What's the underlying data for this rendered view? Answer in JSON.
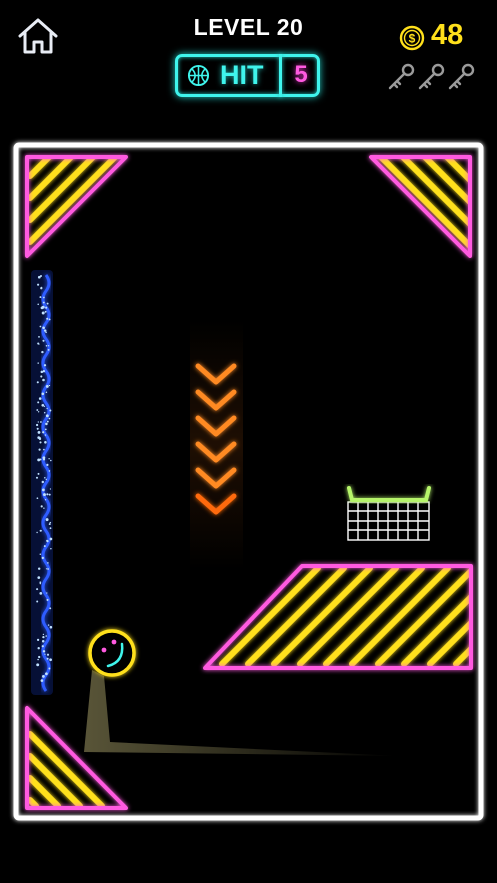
{
  "header": {
    "level_title": "LEVEL 20",
    "hit_label": "HIT",
    "hit_count": "5",
    "coins": "48"
  },
  "icons": {
    "home": "home-icon",
    "basketball": "basketball-icon",
    "coin": "dollar-coin-icon",
    "keys": [
      "key-icon",
      "key-icon",
      "key-icon"
    ]
  },
  "colors": {
    "background": "#000000",
    "frame": "#ffffff",
    "neon_cyan": "#3ff4ec",
    "neon_pink": "#ff5ae0",
    "neon_yellow": "#ffe01b",
    "neon_orange": "#ff7a1a",
    "water_blue": "#2d5bff",
    "hoop_green": "#b6f56a",
    "key_gray": "#9a9a9a"
  }
}
